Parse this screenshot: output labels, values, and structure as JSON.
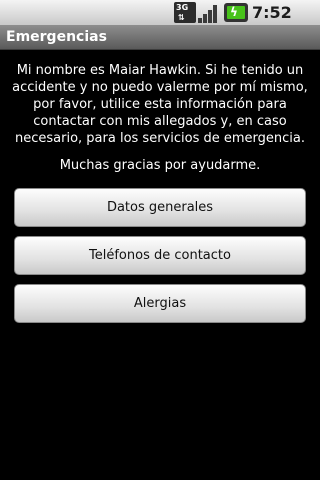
{
  "status_bar": {
    "network_label": "3G",
    "time": "7:52 PM",
    "icons": [
      "network-3g-icon",
      "signal-strength-icon",
      "battery-charging-icon"
    ]
  },
  "app": {
    "title": "Emergencias"
  },
  "main": {
    "message": "Mi nombre es Maiar Hawkin. Si he tenido un accidente y no puedo valerme por mí mismo, por favor, utilice esta información para contactar con mis allegados y, en caso necesario, para los servicios de emergencia.",
    "thanks": "Muchas gracias por ayudarme.",
    "buttons": [
      {
        "label": "Datos generales"
      },
      {
        "label": "Teléfonos de contacto"
      },
      {
        "label": "Alergias"
      }
    ]
  },
  "colors": {
    "background": "#000000",
    "title_bar": "#707070",
    "battery": "#47c21a"
  }
}
